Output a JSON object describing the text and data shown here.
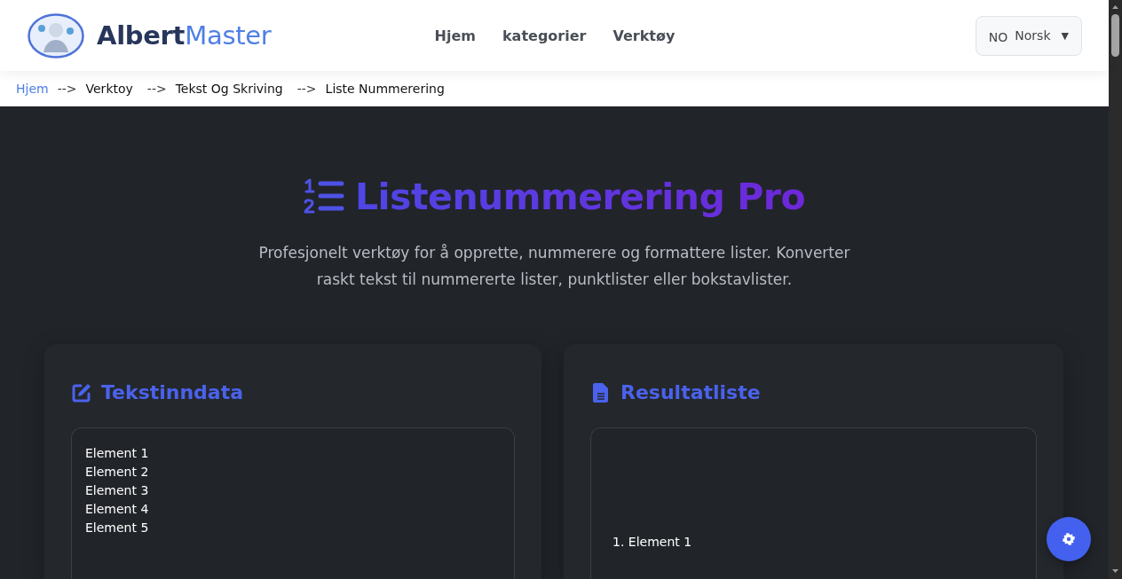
{
  "header": {
    "brand": {
      "part_1": "Albert",
      "part_2": "Master"
    },
    "nav": [
      {
        "label": "Hjem"
      },
      {
        "label": "kategorier"
      },
      {
        "label": "Verktøy"
      }
    ],
    "language": {
      "code": "NO",
      "label": "Norsk",
      "caret": "▼"
    }
  },
  "breadcrumb": [
    {
      "label": "Hjem",
      "kind": "link"
    },
    {
      "label": "Verktoy",
      "kind": "text",
      "separator": "-->"
    },
    {
      "label": "Tekst Og Skriving",
      "kind": "text",
      "separator": "-->"
    },
    {
      "label": "Liste Nummerering",
      "kind": "text",
      "separator": "-->"
    }
  ],
  "hero": {
    "title": "Listenummerering Pro",
    "description": "Profesjonelt verktøy for å opprette, nummerere og formattere lister. Konverter raskt tekst til nummererte lister, punktlister eller bokstavlister."
  },
  "panels": [
    {
      "kind": "input",
      "title": "Tekstinndata",
      "value": "Element 1\nElement 2\nElement 3\nElement 4\nElement 5"
    },
    {
      "kind": "output",
      "title": "Resultatliste",
      "items": [
        "1. Element 1"
      ]
    }
  ]
}
